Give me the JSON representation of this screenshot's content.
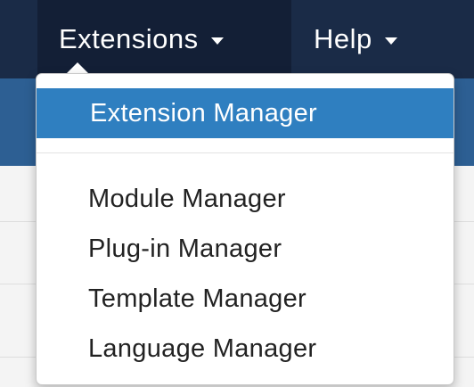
{
  "navbar": {
    "items": [
      {
        "label": "Extensions",
        "icon": "chevron-down-icon",
        "active": true
      },
      {
        "label": "Help",
        "icon": "chevron-down-icon",
        "active": false
      }
    ]
  },
  "dropdown": {
    "header_item": "Extension Manager",
    "items": [
      {
        "label": "Module Manager"
      },
      {
        "label": "Plug-in Manager"
      },
      {
        "label": "Template Manager"
      },
      {
        "label": "Language Manager"
      }
    ]
  },
  "colors": {
    "navbar_bg": "#1a2b47",
    "active_nav_bg": "#131f36",
    "subbar_bg": "#2d5f93",
    "highlight_bg": "#2f7fc0",
    "text_dark": "#222222"
  }
}
